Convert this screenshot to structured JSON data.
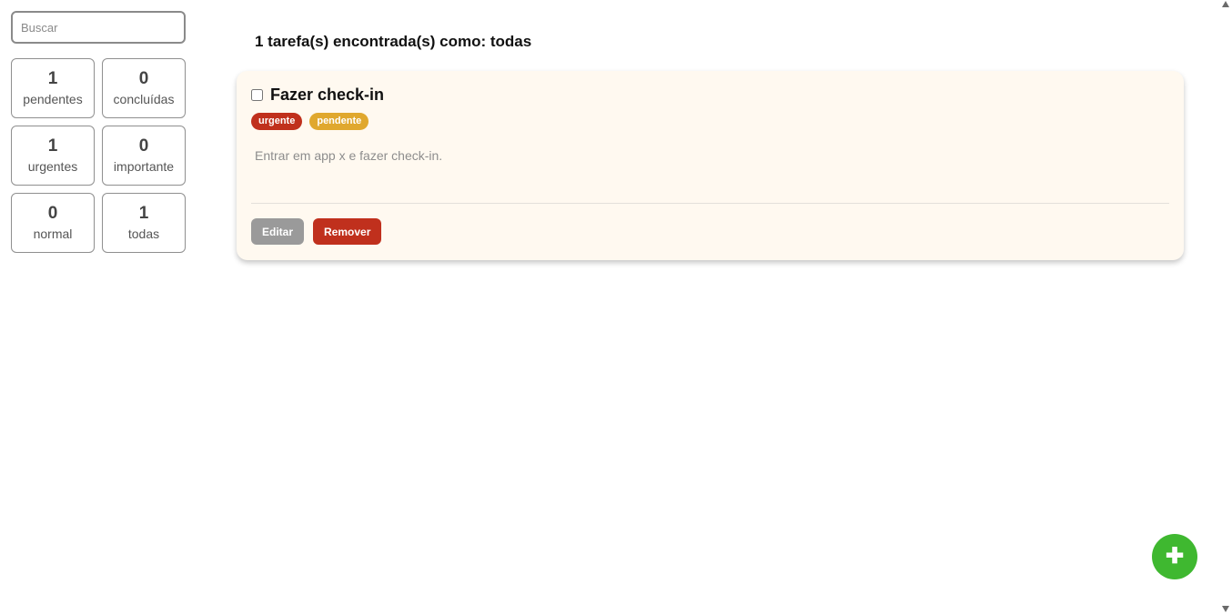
{
  "search": {
    "placeholder": "Buscar"
  },
  "stats": [
    {
      "count": "1",
      "label": "pendentes"
    },
    {
      "count": "0",
      "label": "concluídas"
    },
    {
      "count": "1",
      "label": "urgentes"
    },
    {
      "count": "0",
      "label": "importante"
    },
    {
      "count": "0",
      "label": "normal"
    },
    {
      "count": "1",
      "label": "todas"
    }
  ],
  "main": {
    "heading": "1 tarefa(s) encontrada(s) como: todas",
    "tasks": [
      {
        "title": "Fazer check-in",
        "checked": false,
        "tags": [
          "urgente",
          "pendente"
        ],
        "description": "Entrar em app x e fazer check-in.",
        "edit_label": "Editar",
        "remove_label": "Remover"
      }
    ]
  },
  "fab": {
    "icon": "plus-icon",
    "symbol": "✚"
  },
  "colors": {
    "urgent": "#c0301d",
    "pending": "#e0a82e",
    "fab": "#3fb830",
    "card_bg": "#fff9f0",
    "edit_button": "#9a9a9a"
  }
}
